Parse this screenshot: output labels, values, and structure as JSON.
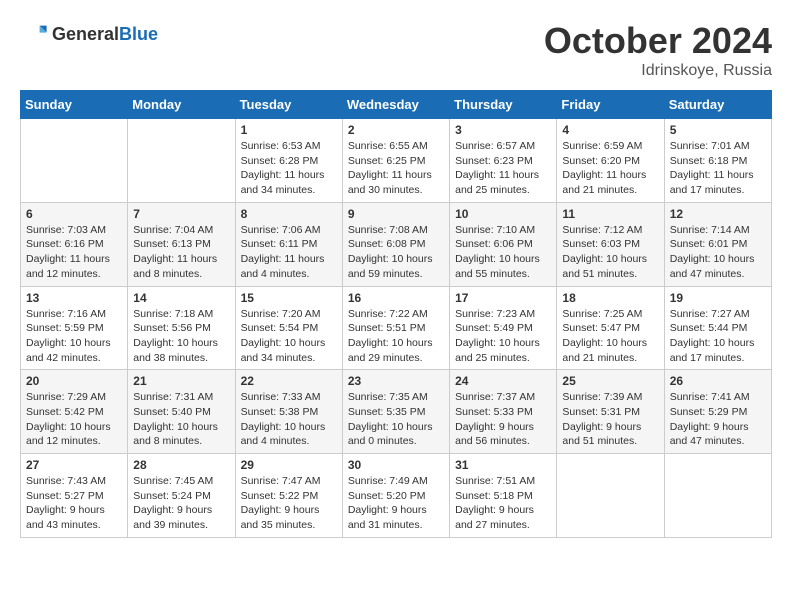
{
  "header": {
    "logo_general": "General",
    "logo_blue": "Blue",
    "title": "October 2024",
    "location": "Idrinskoye, Russia"
  },
  "columns": [
    "Sunday",
    "Monday",
    "Tuesday",
    "Wednesday",
    "Thursday",
    "Friday",
    "Saturday"
  ],
  "weeks": [
    [
      {
        "day": "",
        "sunrise": "",
        "sunset": "",
        "daylight": ""
      },
      {
        "day": "",
        "sunrise": "",
        "sunset": "",
        "daylight": ""
      },
      {
        "day": "1",
        "sunrise": "Sunrise: 6:53 AM",
        "sunset": "Sunset: 6:28 PM",
        "daylight": "Daylight: 11 hours and 34 minutes."
      },
      {
        "day": "2",
        "sunrise": "Sunrise: 6:55 AM",
        "sunset": "Sunset: 6:25 PM",
        "daylight": "Daylight: 11 hours and 30 minutes."
      },
      {
        "day": "3",
        "sunrise": "Sunrise: 6:57 AM",
        "sunset": "Sunset: 6:23 PM",
        "daylight": "Daylight: 11 hours and 25 minutes."
      },
      {
        "day": "4",
        "sunrise": "Sunrise: 6:59 AM",
        "sunset": "Sunset: 6:20 PM",
        "daylight": "Daylight: 11 hours and 21 minutes."
      },
      {
        "day": "5",
        "sunrise": "Sunrise: 7:01 AM",
        "sunset": "Sunset: 6:18 PM",
        "daylight": "Daylight: 11 hours and 17 minutes."
      }
    ],
    [
      {
        "day": "6",
        "sunrise": "Sunrise: 7:03 AM",
        "sunset": "Sunset: 6:16 PM",
        "daylight": "Daylight: 11 hours and 12 minutes."
      },
      {
        "day": "7",
        "sunrise": "Sunrise: 7:04 AM",
        "sunset": "Sunset: 6:13 PM",
        "daylight": "Daylight: 11 hours and 8 minutes."
      },
      {
        "day": "8",
        "sunrise": "Sunrise: 7:06 AM",
        "sunset": "Sunset: 6:11 PM",
        "daylight": "Daylight: 11 hours and 4 minutes."
      },
      {
        "day": "9",
        "sunrise": "Sunrise: 7:08 AM",
        "sunset": "Sunset: 6:08 PM",
        "daylight": "Daylight: 10 hours and 59 minutes."
      },
      {
        "day": "10",
        "sunrise": "Sunrise: 7:10 AM",
        "sunset": "Sunset: 6:06 PM",
        "daylight": "Daylight: 10 hours and 55 minutes."
      },
      {
        "day": "11",
        "sunrise": "Sunrise: 7:12 AM",
        "sunset": "Sunset: 6:03 PM",
        "daylight": "Daylight: 10 hours and 51 minutes."
      },
      {
        "day": "12",
        "sunrise": "Sunrise: 7:14 AM",
        "sunset": "Sunset: 6:01 PM",
        "daylight": "Daylight: 10 hours and 47 minutes."
      }
    ],
    [
      {
        "day": "13",
        "sunrise": "Sunrise: 7:16 AM",
        "sunset": "Sunset: 5:59 PM",
        "daylight": "Daylight: 10 hours and 42 minutes."
      },
      {
        "day": "14",
        "sunrise": "Sunrise: 7:18 AM",
        "sunset": "Sunset: 5:56 PM",
        "daylight": "Daylight: 10 hours and 38 minutes."
      },
      {
        "day": "15",
        "sunrise": "Sunrise: 7:20 AM",
        "sunset": "Sunset: 5:54 PM",
        "daylight": "Daylight: 10 hours and 34 minutes."
      },
      {
        "day": "16",
        "sunrise": "Sunrise: 7:22 AM",
        "sunset": "Sunset: 5:51 PM",
        "daylight": "Daylight: 10 hours and 29 minutes."
      },
      {
        "day": "17",
        "sunrise": "Sunrise: 7:23 AM",
        "sunset": "Sunset: 5:49 PM",
        "daylight": "Daylight: 10 hours and 25 minutes."
      },
      {
        "day": "18",
        "sunrise": "Sunrise: 7:25 AM",
        "sunset": "Sunset: 5:47 PM",
        "daylight": "Daylight: 10 hours and 21 minutes."
      },
      {
        "day": "19",
        "sunrise": "Sunrise: 7:27 AM",
        "sunset": "Sunset: 5:44 PM",
        "daylight": "Daylight: 10 hours and 17 minutes."
      }
    ],
    [
      {
        "day": "20",
        "sunrise": "Sunrise: 7:29 AM",
        "sunset": "Sunset: 5:42 PM",
        "daylight": "Daylight: 10 hours and 12 minutes."
      },
      {
        "day": "21",
        "sunrise": "Sunrise: 7:31 AM",
        "sunset": "Sunset: 5:40 PM",
        "daylight": "Daylight: 10 hours and 8 minutes."
      },
      {
        "day": "22",
        "sunrise": "Sunrise: 7:33 AM",
        "sunset": "Sunset: 5:38 PM",
        "daylight": "Daylight: 10 hours and 4 minutes."
      },
      {
        "day": "23",
        "sunrise": "Sunrise: 7:35 AM",
        "sunset": "Sunset: 5:35 PM",
        "daylight": "Daylight: 10 hours and 0 minutes."
      },
      {
        "day": "24",
        "sunrise": "Sunrise: 7:37 AM",
        "sunset": "Sunset: 5:33 PM",
        "daylight": "Daylight: 9 hours and 56 minutes."
      },
      {
        "day": "25",
        "sunrise": "Sunrise: 7:39 AM",
        "sunset": "Sunset: 5:31 PM",
        "daylight": "Daylight: 9 hours and 51 minutes."
      },
      {
        "day": "26",
        "sunrise": "Sunrise: 7:41 AM",
        "sunset": "Sunset: 5:29 PM",
        "daylight": "Daylight: 9 hours and 47 minutes."
      }
    ],
    [
      {
        "day": "27",
        "sunrise": "Sunrise: 7:43 AM",
        "sunset": "Sunset: 5:27 PM",
        "daylight": "Daylight: 9 hours and 43 minutes."
      },
      {
        "day": "28",
        "sunrise": "Sunrise: 7:45 AM",
        "sunset": "Sunset: 5:24 PM",
        "daylight": "Daylight: 9 hours and 39 minutes."
      },
      {
        "day": "29",
        "sunrise": "Sunrise: 7:47 AM",
        "sunset": "Sunset: 5:22 PM",
        "daylight": "Daylight: 9 hours and 35 minutes."
      },
      {
        "day": "30",
        "sunrise": "Sunrise: 7:49 AM",
        "sunset": "Sunset: 5:20 PM",
        "daylight": "Daylight: 9 hours and 31 minutes."
      },
      {
        "day": "31",
        "sunrise": "Sunrise: 7:51 AM",
        "sunset": "Sunset: 5:18 PM",
        "daylight": "Daylight: 9 hours and 27 minutes."
      },
      {
        "day": "",
        "sunrise": "",
        "sunset": "",
        "daylight": ""
      },
      {
        "day": "",
        "sunrise": "",
        "sunset": "",
        "daylight": ""
      }
    ]
  ]
}
